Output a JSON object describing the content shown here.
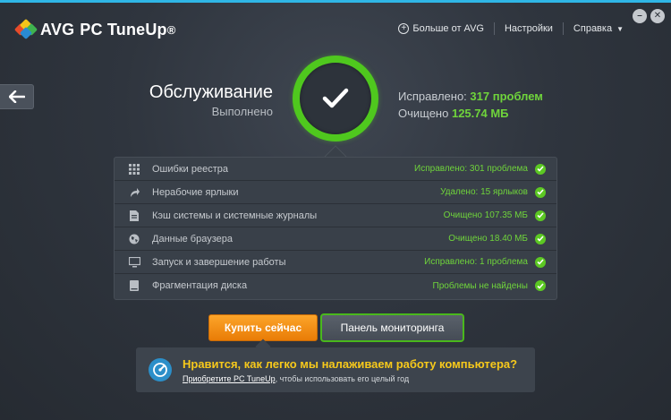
{
  "app": {
    "brand": "AVG",
    "product": "PC TuneUp",
    "reg_mark": "®"
  },
  "colors": {
    "accent_green": "#5cc823",
    "accent_orange": "#f28a12",
    "accent_blue": "#2fb6e6",
    "promo_yellow": "#f7c91b"
  },
  "nav": {
    "more_label": "Больше от AVG",
    "settings_label": "Настройки",
    "help_label": "Справка"
  },
  "window": {
    "minimize_glyph": "–",
    "close_glyph": "✕"
  },
  "header": {
    "title": "Обслуживание",
    "subtitle": "Выполнено",
    "fixed_label": "Исправлено:",
    "fixed_value": "317 проблем",
    "cleaned_label": "Очищено",
    "cleaned_value": "125.74 МБ"
  },
  "icons": {
    "back": "arrow-left-icon",
    "status": "check-circle-icon",
    "center": "checkmark-icon"
  },
  "results": [
    {
      "icon": "registry-grid-icon",
      "label": "Ошибки реестра",
      "status": "Исправлено: 301 проблема"
    },
    {
      "icon": "shortcut-arrow-icon",
      "label": "Нерабочие ярлыки",
      "status": "Удалено: 15 ярлыков"
    },
    {
      "icon": "cache-file-icon",
      "label": "Кэш системы и системные журналы",
      "status": "Очищено 107.35 МБ"
    },
    {
      "icon": "globe-icon",
      "label": "Данные браузера",
      "status": "Очищено 18.40 МБ"
    },
    {
      "icon": "monitor-icon",
      "label": "Запуск и завершение работы",
      "status": "Исправлено: 1 проблема"
    },
    {
      "icon": "disk-icon",
      "label": "Фрагментация диска",
      "status": "Проблемы не найдены"
    }
  ],
  "buttons": {
    "buy_label": "Купить сейчас",
    "monitor_label": "Панель мониторинга"
  },
  "promo": {
    "headline": "Нравится, как легко мы налаживаем работу компьютера?",
    "link_text": "Приобретите PC TuneUp",
    "body_text": ", чтобы использовать его целый год"
  }
}
